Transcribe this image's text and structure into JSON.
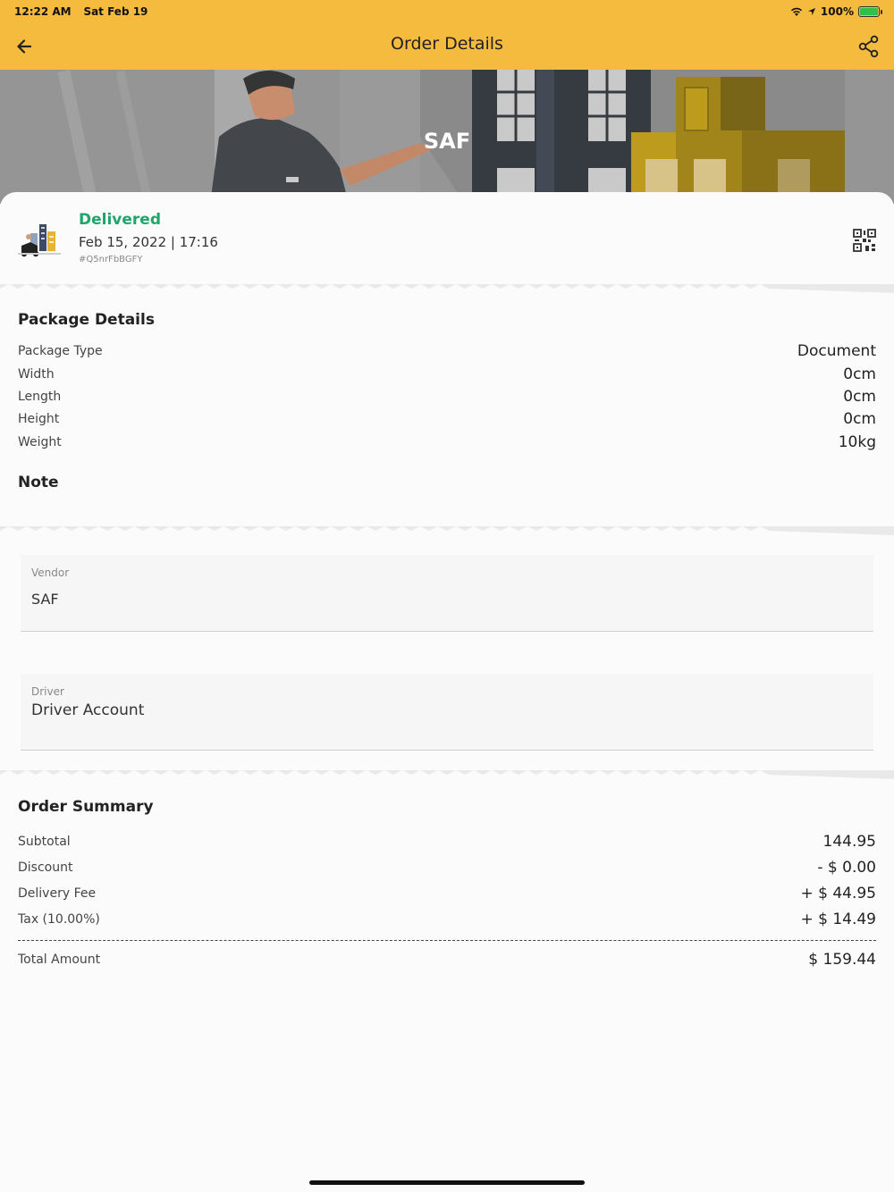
{
  "status_bar": {
    "time": "12:22 AM",
    "date": "Sat Feb 19",
    "battery": "100%"
  },
  "app_bar": {
    "title": "Order Details",
    "back_icon": "arrow-left-icon",
    "share_icon": "share-icon"
  },
  "banner": {
    "title": "SAF"
  },
  "order": {
    "status": "Delivered",
    "datetime": "Feb 15, 2022 | 17:16",
    "id": "#Q5nrFbBGFY",
    "status_color": "#1fa46b"
  },
  "package": {
    "title": "Package Details",
    "rows": [
      {
        "label": "Package Type",
        "value": "Document"
      },
      {
        "label": "Width",
        "value": "0cm"
      },
      {
        "label": "Length",
        "value": "0cm"
      },
      {
        "label": "Height",
        "value": "0cm"
      },
      {
        "label": "Weight",
        "value": "10kg"
      }
    ],
    "note_title": "Note"
  },
  "vendor": {
    "label": "Vendor",
    "value": "SAF"
  },
  "driver": {
    "label": "Driver",
    "value": "Driver Account"
  },
  "summary": {
    "title": "Order Summary",
    "rows": [
      {
        "label": "Subtotal",
        "value": "144.95"
      },
      {
        "label": "Discount",
        "value": "- $ 0.00"
      },
      {
        "label": "Delivery Fee",
        "value": "+ $ 44.95"
      },
      {
        "label": "Tax (10.00%)",
        "value": "+ $ 14.49"
      }
    ],
    "total_label": "Total Amount",
    "total_value": "$ 159.44"
  },
  "colors": {
    "accent": "#f4bb3f"
  }
}
